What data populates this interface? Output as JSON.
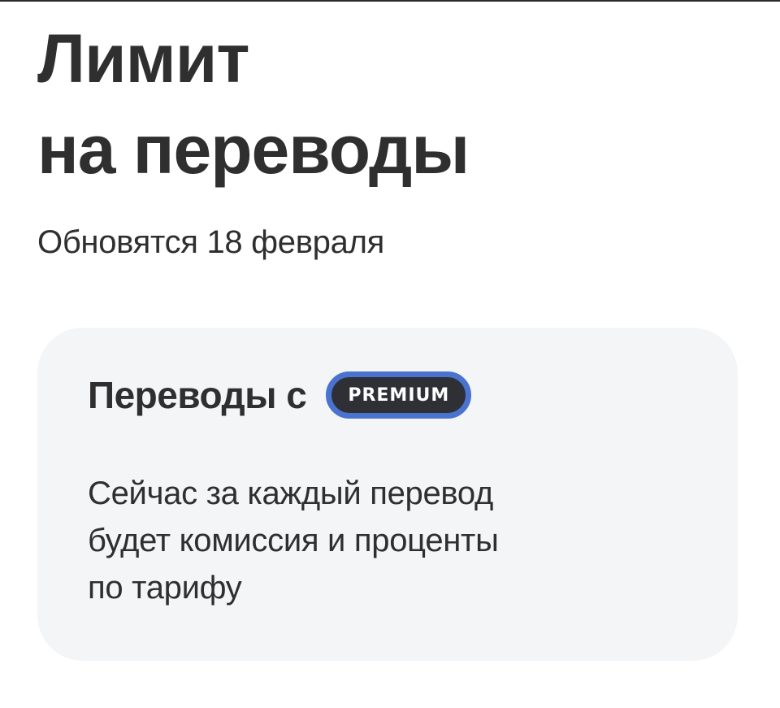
{
  "header": {
    "title_lines": [
      "Лимит",
      "на переводы"
    ],
    "subtitle": "Обновятся 18 февраля"
  },
  "card": {
    "title": "Переводы с",
    "badge": "PREMIUM",
    "text_lines": [
      "Сейчас за каждый перевод",
      "будет комиссия и проценты",
      "по тарифу"
    ]
  },
  "colors": {
    "text": "#2f2f2f",
    "card_background": "#f4f5f7",
    "badge_background": "#2f3036",
    "badge_border": "#4a72cf"
  },
  "icons": []
}
